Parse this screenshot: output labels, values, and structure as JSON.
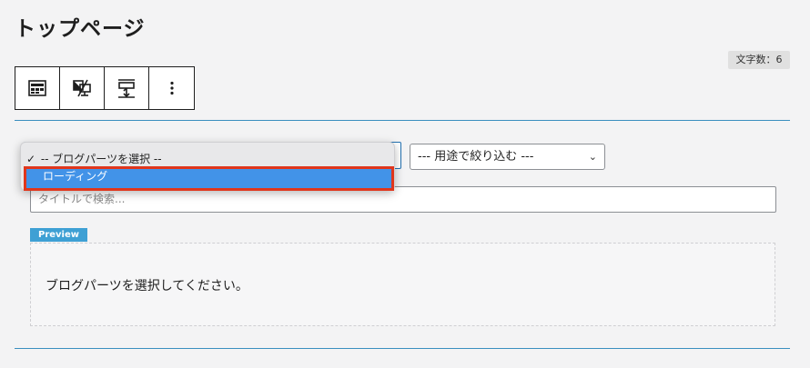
{
  "page": {
    "title": "トップページ"
  },
  "char_count": "文字数：6",
  "toolbar": {
    "buttons": [
      {
        "name": "block-type",
        "icon": "layout-block-icon"
      },
      {
        "name": "toggle-display",
        "icon": "no-display-icon"
      },
      {
        "name": "height-adjust",
        "icon": "vertical-resize-icon"
      },
      {
        "name": "more-options",
        "icon": "more-vertical-icon"
      }
    ]
  },
  "blog_parts_select": {
    "options": [
      {
        "label": "-- ブログパーツを選択 --",
        "selected": true
      },
      {
        "label": "ローディング",
        "highlighted": true
      }
    ]
  },
  "filter_select": {
    "value": "--- 用途で絞り込む ---"
  },
  "search": {
    "placeholder": "タイトルで検索..."
  },
  "preview": {
    "label": "Preview",
    "message": "ブログパーツを選択してください。"
  },
  "colors": {
    "accent": "#3ea0d4",
    "highlight": "#4293e8",
    "annotation": "#e0361c",
    "divider": "#3a8fbf"
  }
}
